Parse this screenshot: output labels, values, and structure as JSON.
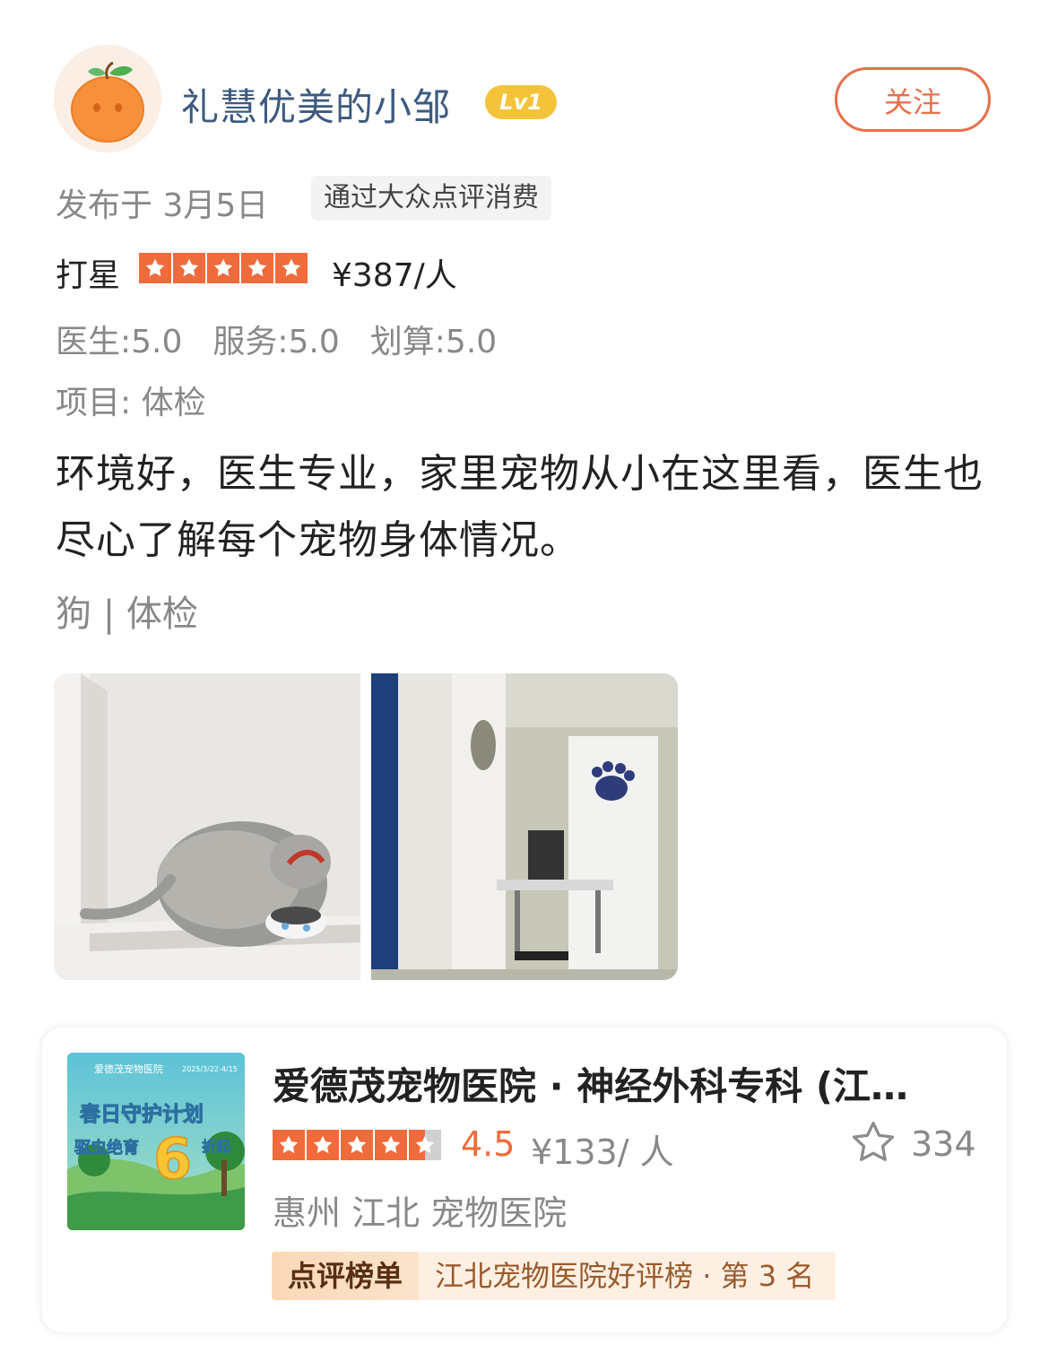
{
  "user": {
    "name": "礼慧优美的小邹",
    "level": "Lv1",
    "follow_label": "关注",
    "avatar_icon": "orange-avatar-icon"
  },
  "review": {
    "date": "发布于 3月5日",
    "source_tag": "通过大众点评消费",
    "rating_label": "打星",
    "stars": 5,
    "price_per_person": "¥387/人",
    "scores": [
      "医生:5.0",
      "服务:5.0",
      "划算:5.0"
    ],
    "project": "项目:  体检",
    "text": "环境好，医生专业，家里宠物从小在这里看，医生也尽心了解每个宠物身体情况。",
    "tags": "狗 | 体检",
    "star_color": "#f06b3b"
  },
  "shop": {
    "name": "爱德茂宠物医院 · 神经外科专科 (江…",
    "rating": "4.5",
    "rating_value": 4.5,
    "price": "¥133/ 人",
    "favorites": "334",
    "region": "惠州 江北 宠物医院",
    "rank_badge": "点评榜单",
    "rank_text": "江北宠物医院好评榜 · 第 3 名",
    "thumb": {
      "clinic_label": "爱德茂宠物医院",
      "date_range": "2025/3/22-4/15",
      "headline": "春日守护计划",
      "promo_left": "驱虫绝育",
      "promo_number": "6",
      "promo_right": "折起"
    }
  }
}
